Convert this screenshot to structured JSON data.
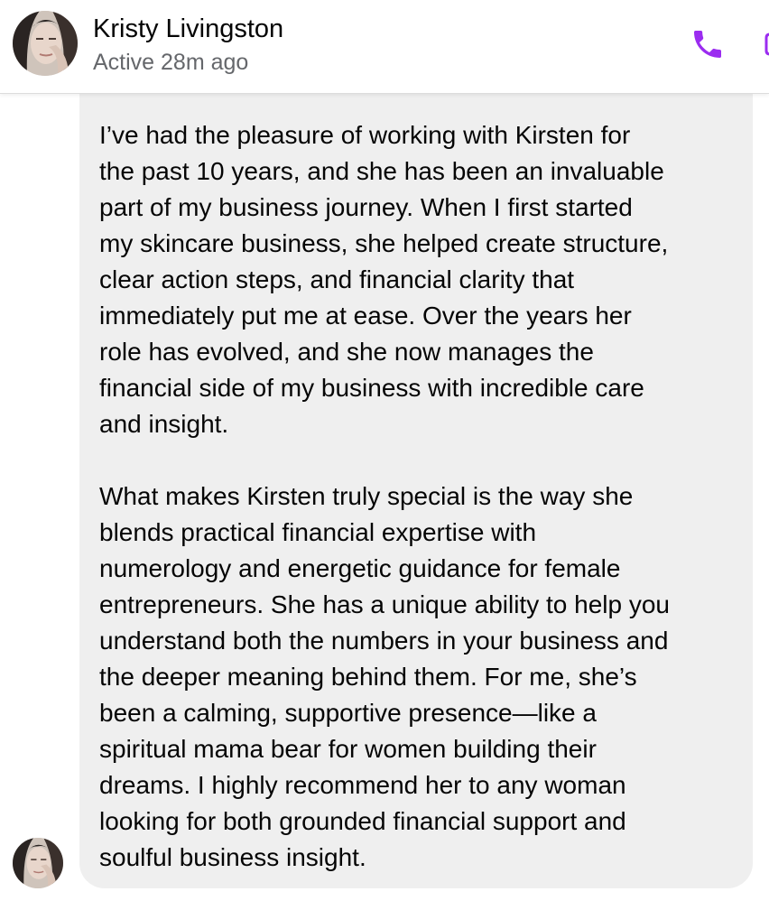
{
  "header": {
    "contact_name": "Kristy Livingston",
    "status": "Active 28m ago",
    "avatar_icon": "contact-avatar",
    "call_icon": "phone-icon",
    "video_icon": "video-call-icon",
    "accent_color": "#9b2cf0"
  },
  "message": {
    "text": "I’ve had the pleasure of working with Kirsten for\nthe past 10 years, and she has been an invaluable\npart of my business journey. When I first started\nmy skincare business, she helped create structure,\nclear action steps, and financial clarity that\nimmediately put me at ease. Over the years her\nrole has evolved, and she now manages the\nfinancial side of my business with incredible care\nand insight.\n\nWhat makes Kirsten truly special is the way she\nblends practical financial expertise with\nnumerology and energetic guidance for female\nentrepreneurs. She has a unique ability to help you\nunderstand both the numbers in your business and\nthe deeper meaning behind them. For me, she’s\nbeen a calming, supportive presence—like a\nspiritual mama bear for women building their\ndreams. I highly recommend her to any woman\nlooking for both grounded financial support and\nsoulful business insight.",
    "bubble_color": "#efefef"
  }
}
